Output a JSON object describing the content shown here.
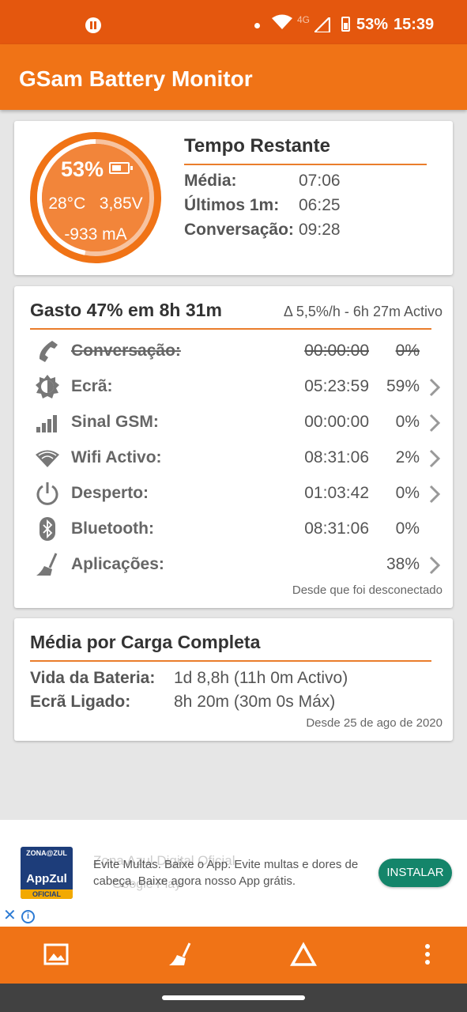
{
  "status_bar": {
    "network": "4G",
    "battery_percent": "53%",
    "time": "15:39"
  },
  "app": {
    "title": "GSam Battery Monitor"
  },
  "battery_gauge": {
    "percent": "53%",
    "temperature": "28°C",
    "voltage": "3,85V",
    "current": "-933 mA",
    "level": 0.53,
    "color": "#f07316"
  },
  "time_remaining": {
    "title": "Tempo Restante",
    "rows": [
      {
        "label": "Média:",
        "value": "07:06"
      },
      {
        "label": "Últimos 1m:",
        "value": "06:25"
      },
      {
        "label": "Conversação:",
        "value": "09:28"
      }
    ]
  },
  "usage": {
    "title": "Gasto 47% em 8h 31m",
    "delta": "Δ 5,5%/h - 6h 27m Activo",
    "rows": [
      {
        "icon": "phone-icon",
        "name": "Conversação:",
        "time": "00:00:00",
        "pct": "0%",
        "struck": true,
        "chevron": false
      },
      {
        "icon": "brightness-icon",
        "name": "Ecrã:",
        "time": "05:23:59",
        "pct": "59%",
        "struck": false,
        "chevron": true
      },
      {
        "icon": "signal-bars-icon",
        "name": "Sinal GSM:",
        "time": "00:00:00",
        "pct": "0%",
        "struck": false,
        "chevron": true
      },
      {
        "icon": "wifi-icon",
        "name": "Wifi Activo:",
        "time": "08:31:06",
        "pct": "2%",
        "struck": false,
        "chevron": true
      },
      {
        "icon": "power-icon",
        "name": "Desperto:",
        "time": "01:03:42",
        "pct": "0%",
        "struck": false,
        "chevron": true
      },
      {
        "icon": "bluetooth-icon",
        "name": "Bluetooth:",
        "time": "08:31:06",
        "pct": "0%",
        "struck": false,
        "chevron": false
      },
      {
        "icon": "broom-icon",
        "name": "Aplicações:",
        "time": "",
        "pct": "38%",
        "struck": false,
        "chevron": true
      }
    ],
    "footer": "Desde que foi desconectado"
  },
  "average": {
    "title": "Média por Carga Completa",
    "rows": [
      {
        "label": "Vida da Bateria:",
        "value": "1d 8,8h (11h 0m Activo)"
      },
      {
        "label": "Ecrã Ligado:",
        "value": "8h 20m (30m 0s Máx)"
      }
    ],
    "footer": "Desde 25 de ago de 2020"
  },
  "ad": {
    "logo_top": "ZONA@ZUL",
    "logo_mid": "AppZul",
    "logo_bottom": "OFICIAL",
    "ghost_title": "Zona Azul Digital Oficial",
    "ghost_store": "Google Play",
    "text": "Evite Multas. Baixe o App. Evite multas e dores de cabeça. Baixe agora nosso App grátis.",
    "button": "INSTALAR",
    "close_glyph": "✕",
    "info_glyph": "i"
  },
  "bottom_bar": {
    "icons": [
      "image-icon",
      "broom-icon",
      "triangle-icon",
      "more-vert-icon"
    ]
  }
}
